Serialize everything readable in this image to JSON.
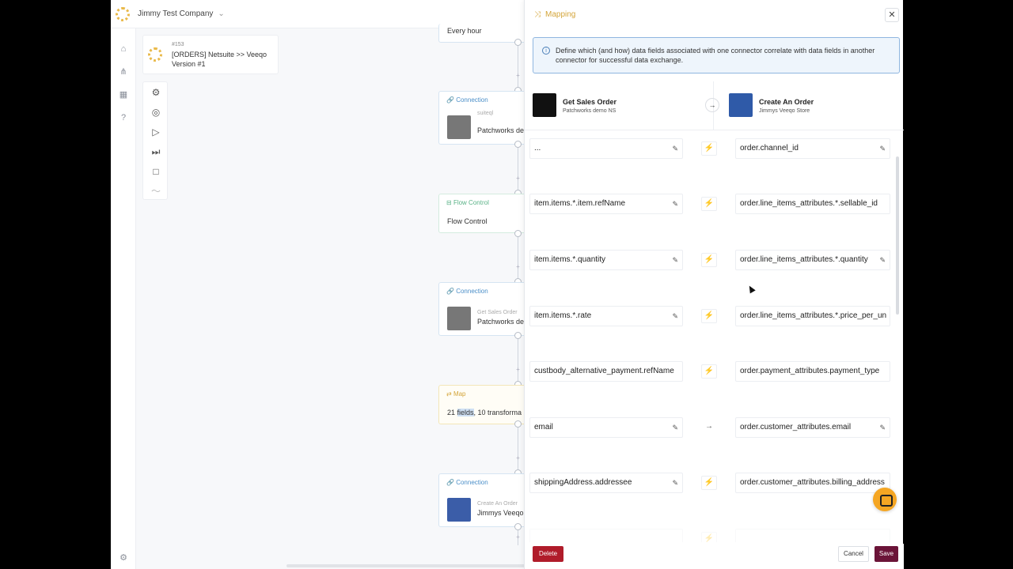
{
  "topbar": {
    "company": "Jimmy Test Company"
  },
  "flow": {
    "number": "#153",
    "name": "[ORDERS] Netsuite >> Veeqo Version #1"
  },
  "canvas": {
    "schedule": "Every hour",
    "nodes": [
      {
        "type": "Connection",
        "sub": "suiteql",
        "body": "Patchworks de"
      },
      {
        "type": "Flow Control",
        "body": "Flow Control"
      },
      {
        "type": "Connection",
        "sub": "Get Sales Order",
        "body": "Patchworks de"
      },
      {
        "type": "Map",
        "body_pre": "21 ",
        "body_hl": "fields",
        "body_post": ", 10 transforma"
      },
      {
        "type": "Connection",
        "sub": "Create An Order",
        "body": "Jimmys Veeqo"
      }
    ]
  },
  "panel": {
    "title": "Mapping",
    "info": "Define which (and how) data fields associated with one connector correlate with data fields in another connector for successful data exchange.",
    "source": {
      "name": "Get Sales Order",
      "sub": "Patchworks demo NS"
    },
    "target": {
      "name": "Create An Order",
      "sub": "Jimmys Veeqo Store"
    },
    "rows": [
      {
        "src": "...",
        "dst": "order.channel_id",
        "mode": "transform"
      },
      {
        "src": "item.items.*.item.refName",
        "dst": "order.line_items_attributes.*.sellable_id",
        "mode": "transform"
      },
      {
        "src": "item.items.*.quantity",
        "dst": "order.line_items_attributes.*.quantity",
        "mode": "transform"
      },
      {
        "src": "item.items.*.rate",
        "dst": "order.line_items_attributes.*.price_per_un",
        "mode": "transform"
      },
      {
        "src": "custbody_alternative_payment.refName",
        "dst": "order.payment_attributes.payment_type",
        "mode": "transform"
      },
      {
        "src": "email",
        "dst": "order.customer_attributes.email",
        "mode": "direct"
      },
      {
        "src": "shippingAddress.addressee",
        "dst": "order.customer_attributes.billing_address",
        "mode": "transform"
      }
    ],
    "buttons": {
      "delete": "Delete",
      "cancel": "Cancel",
      "save": "Save"
    }
  }
}
